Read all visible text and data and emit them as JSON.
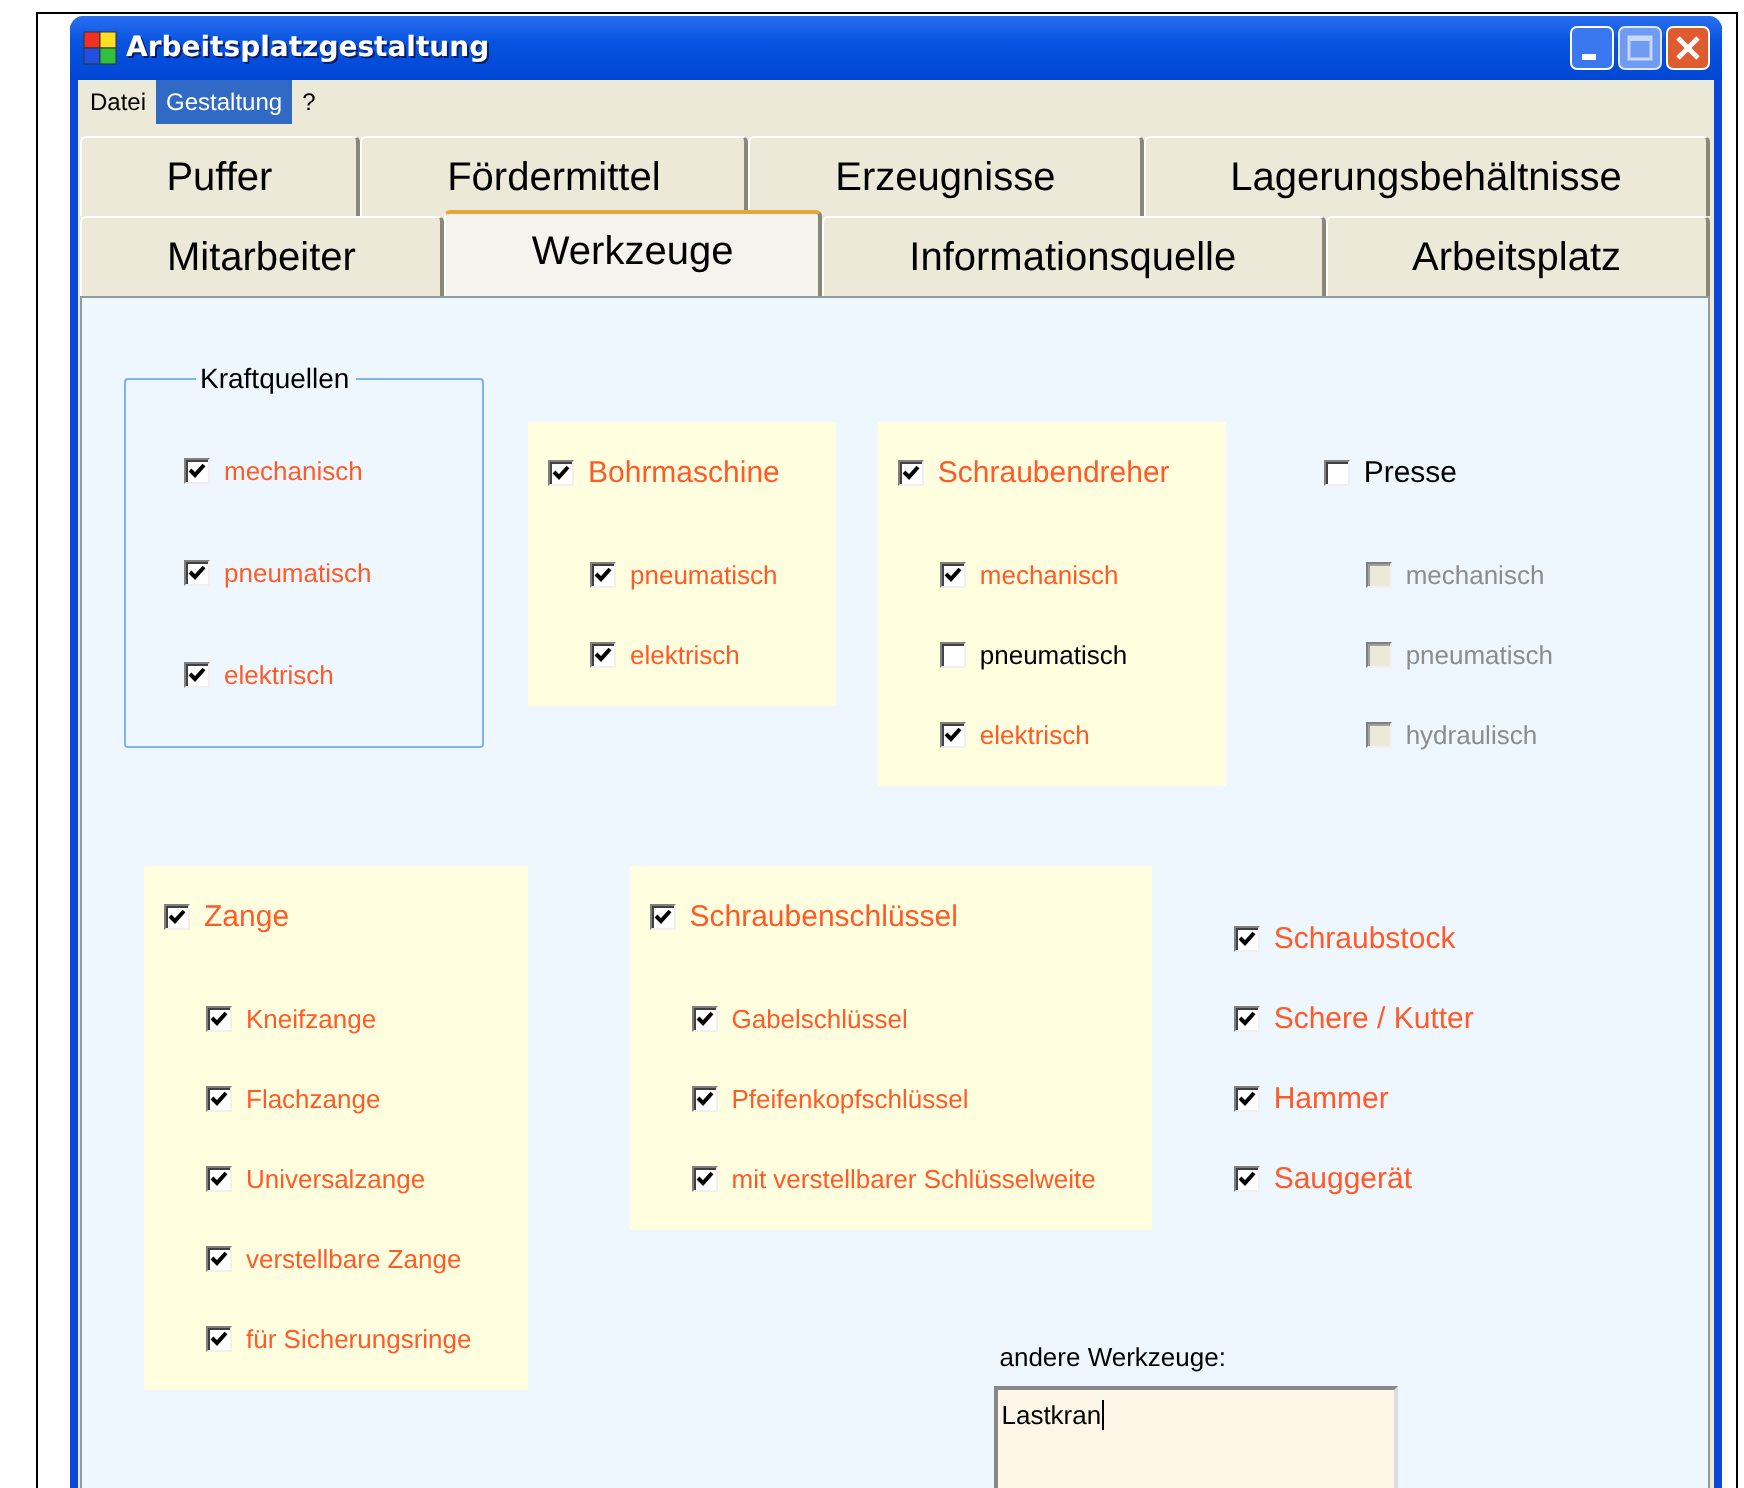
{
  "window": {
    "title": "Arbeitsplatzgestaltung"
  },
  "menu": [
    {
      "label": "Datei",
      "selected": false
    },
    {
      "label": "Gestaltung",
      "selected": true
    },
    {
      "label": "?",
      "selected": false
    }
  ],
  "tab_rows": [
    {
      "tabs": [
        {
          "label": "Puffer",
          "selected": false
        },
        {
          "label": "Fördermittel",
          "selected": false
        },
        {
          "label": "Erzeugnisse",
          "selected": false
        },
        {
          "label": "Lagerungsbehältnisse",
          "selected": false
        }
      ]
    },
    {
      "tabs": [
        {
          "label": "Mitarbeiter",
          "selected": false
        },
        {
          "label": "Werkzeuge",
          "selected": true
        },
        {
          "label": "Informationsquelle",
          "selected": false
        },
        {
          "label": "Arbeitsplatz",
          "selected": false
        }
      ]
    }
  ],
  "rows": [
    {
      "groups": [
        {
          "kind": "frame",
          "title": "Kraftquellen",
          "items": [
            {
              "label": "mechanisch",
              "checked": true,
              "disabled": false
            },
            {
              "label": "pneumatisch",
              "checked": true,
              "disabled": false
            },
            {
              "label": "elektrisch",
              "checked": true,
              "disabled": false
            }
          ]
        },
        {
          "kind": "panel",
          "head": {
            "label": "Bohrmaschine",
            "checked": true,
            "disabled": false
          },
          "items": [
            {
              "label": "pneumatisch",
              "checked": true,
              "disabled": false
            },
            {
              "label": "elektrisch",
              "checked": true,
              "disabled": false
            }
          ]
        },
        {
          "kind": "panel",
          "head": {
            "label": "Schraubendreher",
            "checked": true,
            "disabled": false
          },
          "items": [
            {
              "label": "mechanisch",
              "checked": true,
              "disabled": false
            },
            {
              "label": "pneumatisch",
              "checked": false,
              "disabled": false
            },
            {
              "label": "elektrisch",
              "checked": true,
              "disabled": false
            }
          ]
        },
        {
          "kind": "plain",
          "head": {
            "label": "Presse",
            "checked": false,
            "disabled": false
          },
          "items": [
            {
              "label": "mechanisch",
              "checked": false,
              "disabled": true
            },
            {
              "label": "pneumatisch",
              "checked": false,
              "disabled": true
            },
            {
              "label": "hydraulisch",
              "checked": false,
              "disabled": true
            }
          ]
        }
      ]
    },
    {
      "groups": [
        {
          "kind": "panel",
          "head": {
            "label": "Zange",
            "checked": true,
            "disabled": false
          },
          "items": [
            {
              "label": "Kneifzange",
              "checked": true,
              "disabled": false
            },
            {
              "label": "Flachzange",
              "checked": true,
              "disabled": false
            },
            {
              "label": "Universalzange",
              "checked": true,
              "disabled": false
            },
            {
              "label": "verstellbare Zange",
              "checked": true,
              "disabled": false
            },
            {
              "label": "für Sicherungsringe",
              "checked": true,
              "disabled": false
            }
          ]
        },
        {
          "kind": "panel",
          "head": {
            "label": "Schraubenschlüssel",
            "checked": true,
            "disabled": false
          },
          "items": [
            {
              "label": "Gabelschlüssel",
              "checked": true,
              "disabled": false
            },
            {
              "label": "Pfeifenkopfschlüssel",
              "checked": true,
              "disabled": false
            },
            {
              "label": "mit verstellbarer Schlüsselweite",
              "checked": true,
              "disabled": false
            }
          ]
        },
        {
          "kind": "list",
          "items": [
            {
              "label": "Schraubstock",
              "checked": true,
              "disabled": false
            },
            {
              "label": "Schere / Kutter",
              "checked": true,
              "disabled": false
            },
            {
              "label": "Hammer",
              "checked": true,
              "disabled": false
            },
            {
              "label": "Sauggerät",
              "checked": true,
              "disabled": false
            }
          ]
        }
      ]
    }
  ],
  "other_tools": {
    "label": "andere Werkzeuge:",
    "value": "Lastkran"
  }
}
